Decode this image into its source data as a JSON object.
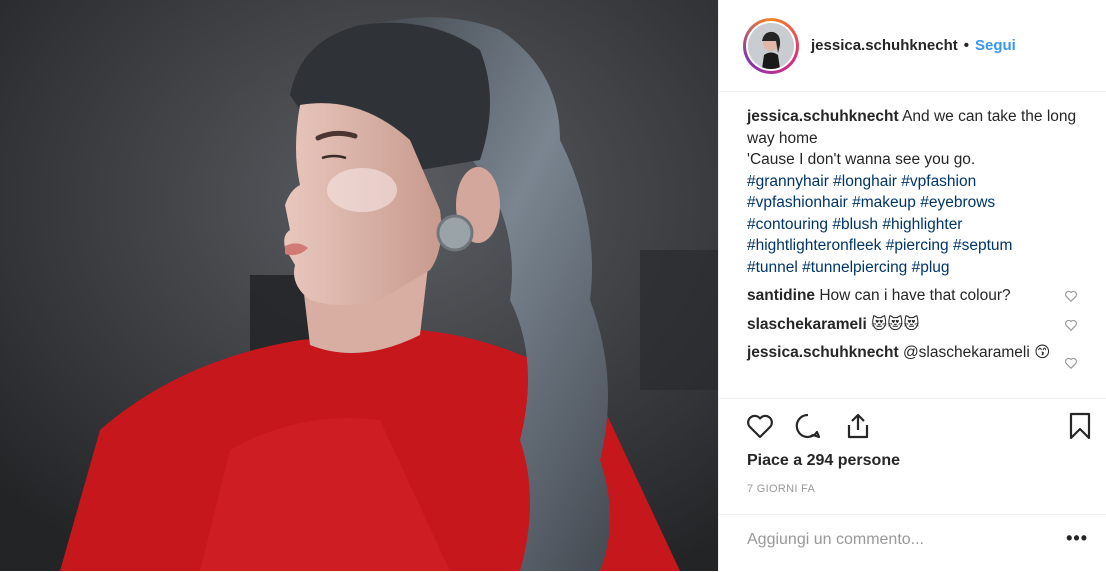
{
  "post": {
    "username": "jessica.schuhknecht",
    "separator": "•",
    "follow_label": "Segui"
  },
  "caption": {
    "username": "jessica.schuhknecht",
    "text_line1": "And we can take the long way home",
    "text_line2": "'Cause I don't wanna see you go.",
    "hashtags": [
      "#grannyhair",
      "#longhair",
      "#vpfashion",
      "#vpfashionhair",
      "#makeup",
      "#eyebrows",
      "#contouring",
      "#blush",
      "#highlighter",
      "#hightlighteronfleek",
      "#piercing",
      "#septum",
      "#tunnel",
      "#tunnelpiercing",
      "#plug"
    ]
  },
  "comments": [
    {
      "username": "santidine",
      "text": "How can i have that colour?"
    },
    {
      "username": "slaschekarameli",
      "text": "😻😻😻"
    },
    {
      "username": "jessica.schuhknecht",
      "text": "@slaschekarameli 😙"
    }
  ],
  "stats": {
    "likes_text": "Piace a 294 persone",
    "time_text": "7 GIORNI FA"
  },
  "add_comment": {
    "placeholder": "Aggiungi un commento...",
    "more_label": "•••"
  },
  "icons": [
    "heart-icon",
    "comment-icon",
    "share-icon",
    "bookmark-icon",
    "more-icon"
  ],
  "colors": {
    "link": "#3897f0",
    "hashtag": "#003569",
    "muted": "#999999",
    "text": "#262626"
  }
}
